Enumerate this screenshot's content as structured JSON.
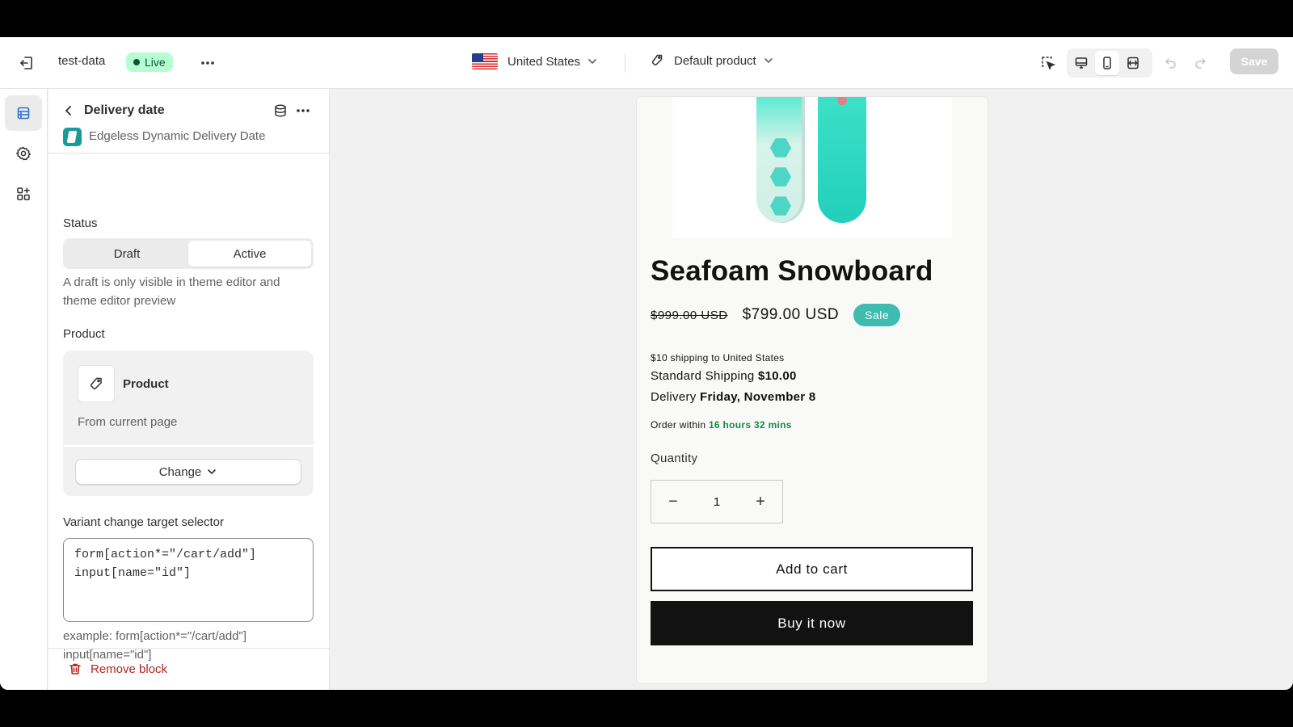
{
  "topbar": {
    "store_name": "test-data",
    "live_label": "Live",
    "country": "United States",
    "template": "Default product",
    "save_label": "Save"
  },
  "panel": {
    "title": "Delivery date",
    "app_name": "Edgeless Dynamic Delivery Date",
    "status_label": "Status",
    "status_options": [
      "Draft",
      "Active"
    ],
    "status_selected": "Active",
    "status_help": "A draft is only visible in theme editor and theme editor preview",
    "product_label": "Product",
    "product_name": "Product",
    "product_source": "From current page",
    "change_label": "Change",
    "selector_label": "Variant change target selector",
    "selector_value": "form[action*=\"/cart/add\"]\ninput[name=\"id\"]",
    "selector_example": "example: form[action*=\"/cart/add\"] input[name=\"id\"]",
    "remove_label": "Remove block"
  },
  "preview": {
    "product_title": "Seafoam Snowboard",
    "compare_price": "$999.00 USD",
    "price": "$799.00 USD",
    "sale_badge": "Sale",
    "shipping_note": "$10 shipping to United States",
    "standard_shipping_label": "Standard Shipping",
    "standard_shipping_value": "$10.00",
    "delivery_label": "Delivery",
    "delivery_value": "Friday, November 8",
    "order_within_label": "Order within",
    "order_within_value": "16 hours 32 mins",
    "quantity_label": "Quantity",
    "quantity_value": "1",
    "qty_minus": "−",
    "qty_plus": "+",
    "add_to_cart": "Add to cart",
    "buy_now": "Buy it now"
  },
  "colors": {
    "live_badge_bg": "#b4fed2",
    "sale_badge_bg": "#3ebcb0",
    "order_within_green": "#1a8a4e",
    "remove_red": "#b3261e",
    "buy_button_bg": "#121212"
  },
  "icons": {
    "exit": "exit-icon",
    "more": "more-horizontal-icon",
    "tag": "tag-icon",
    "chevron": "chevron-down-icon",
    "inspector": "select-cursor-icon",
    "desktop": "desktop-icon",
    "mobile": "mobile-icon",
    "fullwidth": "fullwidth-icon",
    "undo": "undo-icon",
    "redo": "redo-icon",
    "sections": "sections-icon",
    "settings": "gear-icon",
    "apps": "apps-icon",
    "back": "chevron-left-icon",
    "database": "database-icon",
    "trash": "trash-icon"
  }
}
